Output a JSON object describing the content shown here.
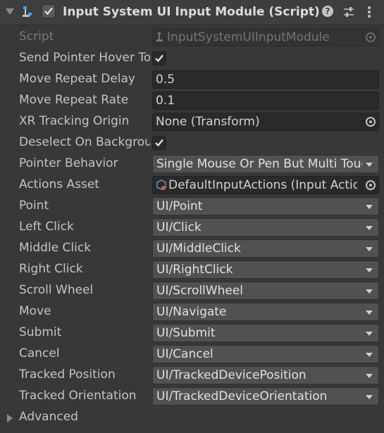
{
  "header": {
    "title": "Input System UI Input Module (Script)",
    "enabled": true,
    "help_glyph": "?",
    "icons": [
      "foldout-arrow-icon",
      "script-icon",
      "help-icon",
      "presets-icon",
      "context-menu-icon"
    ]
  },
  "script": {
    "label": "Script",
    "value": "InputSystemUIInputModule"
  },
  "send_pointer_hover": {
    "label": "Send Pointer Hover To Parent",
    "checked": true
  },
  "move_repeat_delay": {
    "label": "Move Repeat Delay",
    "value": "0.5"
  },
  "move_repeat_rate": {
    "label": "Move Repeat Rate",
    "value": "0.1"
  },
  "xr_tracking_origin": {
    "label": "XR Tracking Origin",
    "value": "None (Transform)"
  },
  "deselect_on_background": {
    "label": "Deselect On Background Click",
    "checked": true
  },
  "pointer_behavior": {
    "label": "Pointer Behavior",
    "value": "Single Mouse Or Pen But Multi Touch And Track"
  },
  "actions_asset": {
    "label": "Actions Asset",
    "value": "DefaultInputActions (Input Action Asset)"
  },
  "actions": [
    {
      "label": "Point",
      "value": "UI/Point"
    },
    {
      "label": "Left Click",
      "value": "UI/Click"
    },
    {
      "label": "Middle Click",
      "value": "UI/MiddleClick"
    },
    {
      "label": "Right Click",
      "value": "UI/RightClick"
    },
    {
      "label": "Scroll Wheel",
      "value": "UI/ScrollWheel"
    },
    {
      "label": "Move",
      "value": "UI/Navigate"
    },
    {
      "label": "Submit",
      "value": "UI/Submit"
    },
    {
      "label": "Cancel",
      "value": "UI/Cancel"
    },
    {
      "label": "Tracked Position",
      "value": "UI/TrackedDevicePosition"
    },
    {
      "label": "Tracked Orientation",
      "value": "UI/TrackedDeviceOrientation"
    }
  ],
  "advanced": {
    "label": "Advanced",
    "expanded": false
  },
  "colors": {
    "background": "#383838",
    "header": "#3e3e3e",
    "field": "#2a2a2a",
    "dropdown": "#515151",
    "text": "#c4c4c4",
    "accent_blue": "#4a9eff"
  }
}
